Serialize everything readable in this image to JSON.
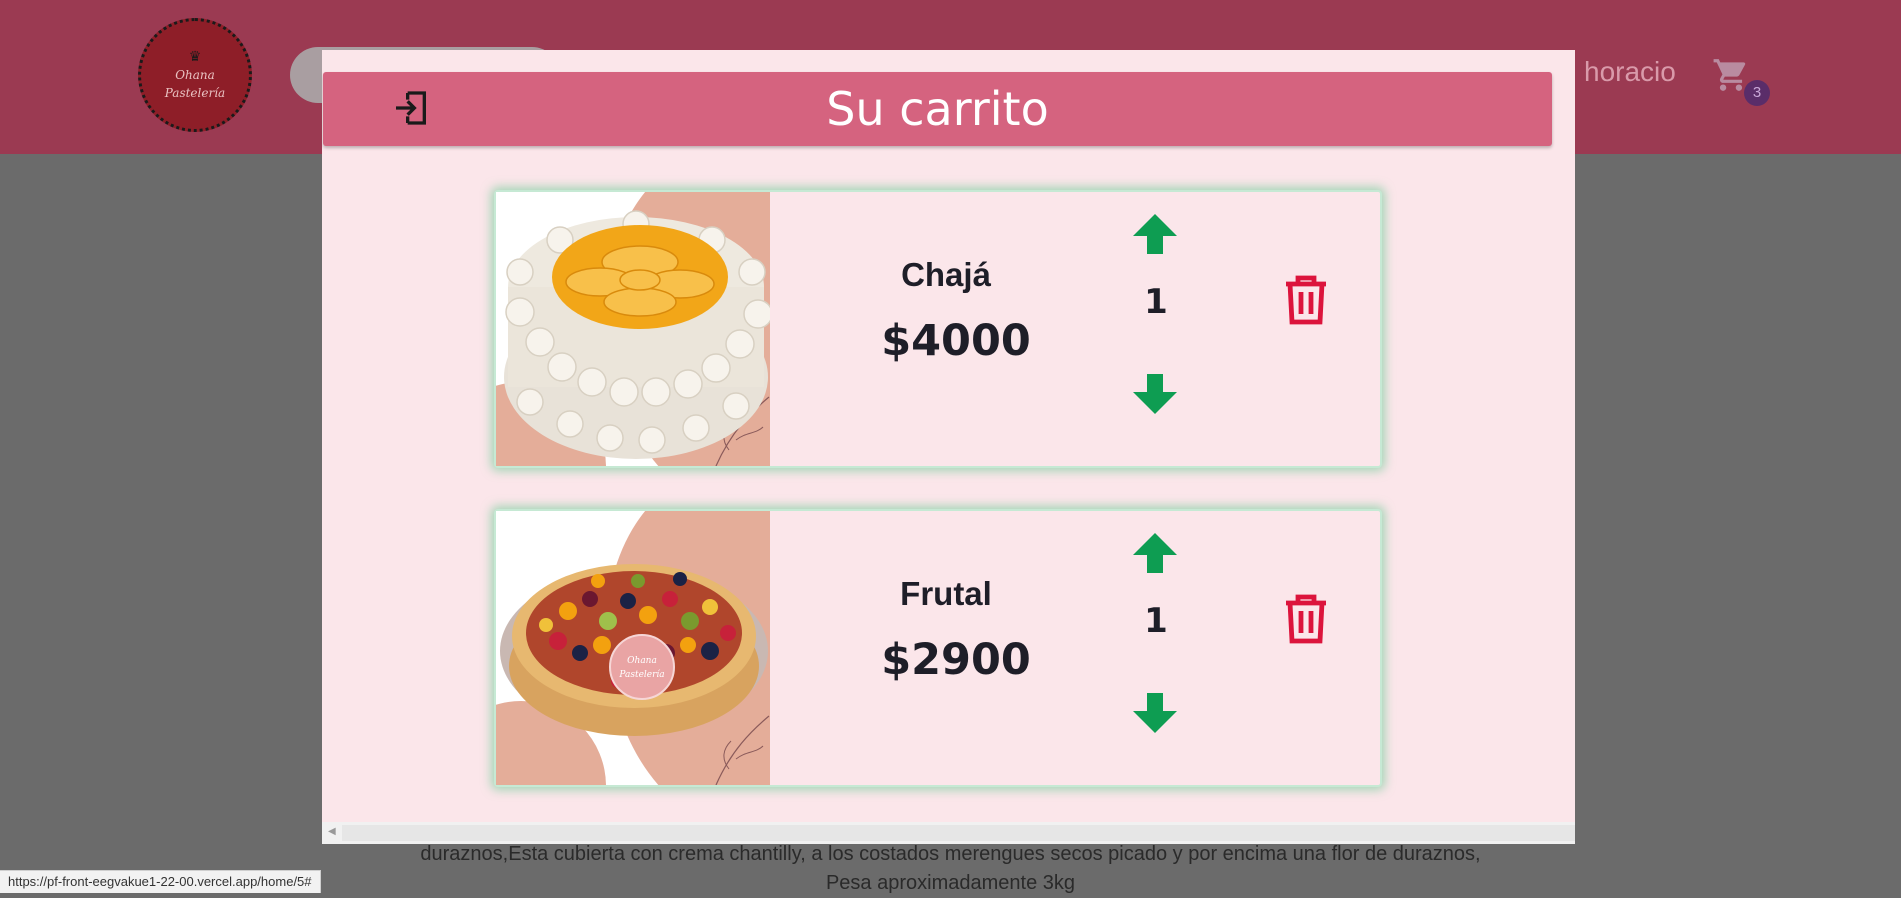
{
  "header": {
    "logo_line1": "Ohana",
    "logo_line2": "Pastelería",
    "user_name": "horacio",
    "cart_count": "3"
  },
  "page": {
    "description_line1": "duraznos,Esta cubierta con crema chantilly, a los costados merengues secos picado y por encima una flor de duraznos,",
    "description_line2": "Pesa aproximadamente 3kg",
    "status_url": "https://pf-front-eegvakue1-22-00.vercel.app/home/5#"
  },
  "modal": {
    "title": "Su carrito",
    "items": [
      {
        "name": "Chajá",
        "price": "$4000",
        "quantity": "1"
      },
      {
        "name": "Frutal",
        "price": "$2900",
        "quantity": "1"
      }
    ],
    "stamp_line1": "Ohana",
    "stamp_line2": "Pastelería"
  },
  "colors": {
    "header_bg": "#d5637f",
    "modal_bg": "#fbe6ea",
    "arrow_green": "#0e9d52",
    "trash_red": "#dc143c"
  },
  "icons": {
    "exit": "exit-icon",
    "cart": "shopping-cart-icon",
    "up": "arrow-up-icon",
    "down": "arrow-down-icon",
    "delete": "trash-icon"
  }
}
